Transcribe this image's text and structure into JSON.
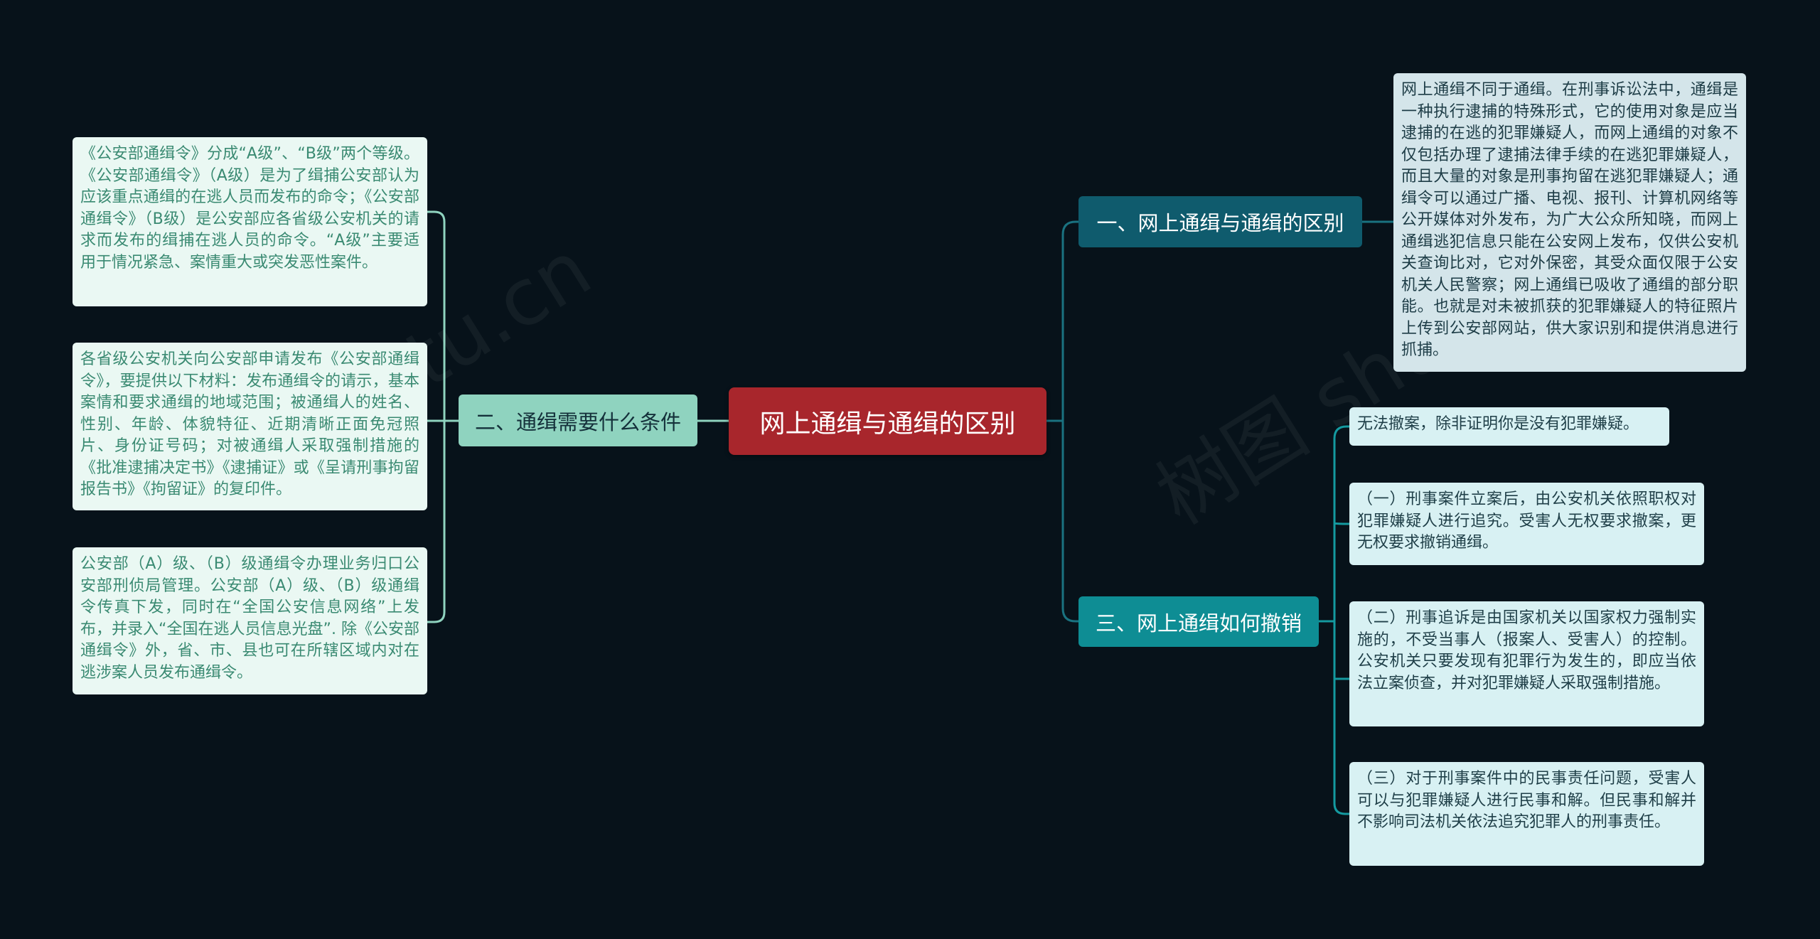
{
  "root": {
    "label": "网上通缉与通缉的区别"
  },
  "branches": {
    "left": {
      "label": "二、通缉需要什么条件",
      "items": [
        "《公安部通缉令》分成“A级”、“B级”两个等级。《公安部通缉令》（A级）是为了缉捕公安部认为应该重点通缉的在逃人员而发布的命令；《公安部通缉令》（B级）是公安部应各省级公安机关的请求而发布的缉捕在逃人员的命令。“A级”主要适用于情况紧急、案情重大或突发恶性案件。",
        "各省级公安机关向公安部申请发布《公安部通缉令》，要提供以下材料：发布通缉令的请示，基本案情和要求通缉的地域范围；被通缉人的姓名、性别、年龄、体貌特征、近期清晰正面免冠照片、身份证号码；对被通缉人采取强制措施的《批准逮捕决定书》《逮捕证》或《呈请刑事拘留报告书》《拘留证》的复印件。",
        "公安部（A）级、（B）级通缉令办理业务归口公安部刑侦局管理。公安部（A）级、（B）级通缉令传真下发，同时在“全国公安信息网络”上发布，并录入“全国在逃人员信息光盘”. 除《公安部通缉令》外，省、市、县也可在所辖区域内对在逃涉案人员发布通缉令。"
      ]
    },
    "right1": {
      "label": "一、网上通缉与通缉的区别",
      "items": [
        "网上通缉不同于通缉。在刑事诉讼法中，通缉是一种执行逮捕的特殊形式，它的使用对象是应当逮捕的在逃的犯罪嫌疑人，而网上通缉的对象不仅包括办理了逮捕法律手续的在逃犯罪嫌疑人，而且大量的对象是刑事拘留在逃犯罪嫌疑人；通缉令可以通过广播、电视、报刊、计算机网络等公开媒体对外发布，为广大公众所知晓，而网上通缉逃犯信息只能在公安网上发布，仅供公安机关查询比对，它对外保密，其受众面仅限于公安机关人民警察；网上通缉已吸收了通缉的部分职能。也就是对未被抓获的犯罪嫌疑人的特征照片上传到公安部网站，供大家识别和提供消息进行抓捕。"
      ]
    },
    "right3": {
      "label": "三、网上通缉如何撤销",
      "items": [
        "无法撤案，除非证明你是没有犯罪嫌疑。",
        "（一）刑事案件立案后，由公安机关依照职权对犯罪嫌疑人进行追究。受害人无权要求撤案，更无权要求撤销通缉。",
        "（二）刑事追诉是由国家机关以国家权力强制实施的，不受当事人（报案人、受害人）的控制。公安机关只要发现有犯罪行为发生的，即应当依法立案侦查，并对犯罪嫌疑人采取强制措施。",
        "（三）对于刑事案件中的民事责任问题，受害人可以与犯罪嫌疑人进行民事和解。但民事和解并不影响司法机关依法追究犯罪人的刑事责任。"
      ]
    }
  },
  "watermarks": [
    "shutu.cn",
    "树图 shu"
  ],
  "colors": {
    "background": "#07121a",
    "root": "#a8262c",
    "branch_left": "#8fd3bf",
    "branch_right1": "#0f5b6d",
    "branch_right3": "#0e8d94",
    "connector_left": "#8fd3bf",
    "connector_right1": "#1a7280",
    "connector_right3": "#149aa0"
  }
}
